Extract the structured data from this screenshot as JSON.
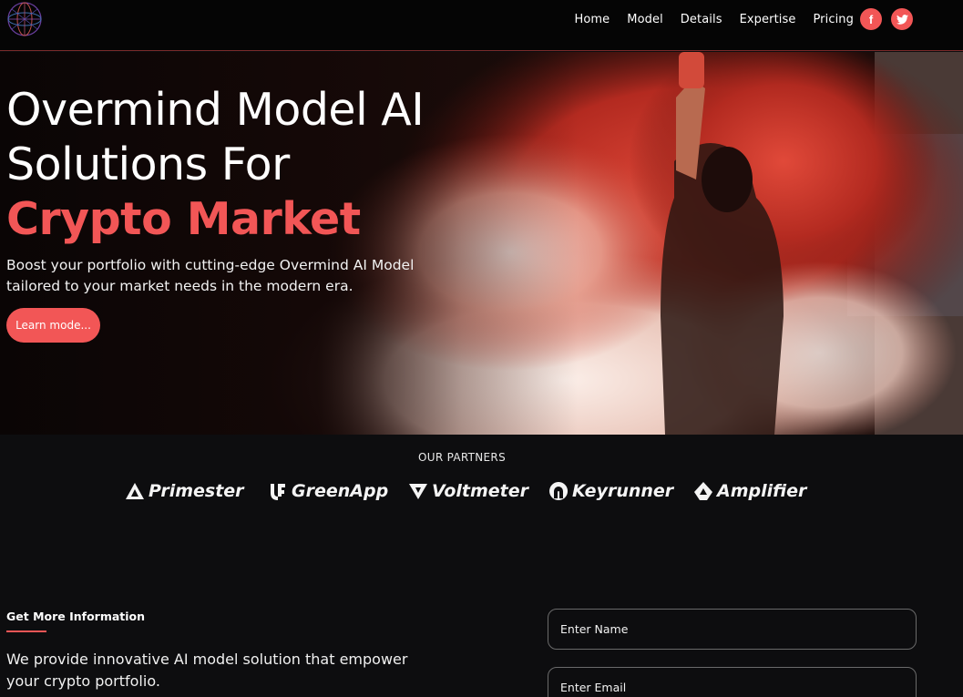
{
  "nav": {
    "links": [
      "Home",
      "Model",
      "Details",
      "Expertise",
      "Pricing"
    ],
    "social": [
      {
        "icon": "facebook-icon",
        "glyph": "f"
      },
      {
        "icon": "twitter-icon",
        "glyph": "t"
      }
    ]
  },
  "hero": {
    "title_line1": "Overmind Model AI",
    "title_line2": "Solutions For",
    "title_accent": "Crypto Market",
    "subtitle": "Boost your portfolio with cutting-edge Overmind AI Model tailored to your market needs in the modern era.",
    "cta_label": "Learn mode..."
  },
  "partners": {
    "heading": "OUR PARTNERS",
    "items": [
      {
        "name": "Primester",
        "icon": "primester-logo-icon"
      },
      {
        "name": "GreenApp",
        "icon": "greenapp-logo-icon"
      },
      {
        "name": "Voltmeter",
        "icon": "voltmeter-logo-icon"
      },
      {
        "name": "Keyrunner",
        "icon": "keyrunner-logo-icon"
      },
      {
        "name": "Amplifier",
        "icon": "amplifier-logo-icon"
      }
    ]
  },
  "info": {
    "heading": "Get More Information",
    "text": "We provide innovative AI model solution that empower your crypto portfolio."
  },
  "form": {
    "name_placeholder": "Enter Name",
    "email_placeholder": "Enter Email"
  },
  "colors": {
    "accent": "#f25656",
    "background": "#0d0d0f"
  }
}
